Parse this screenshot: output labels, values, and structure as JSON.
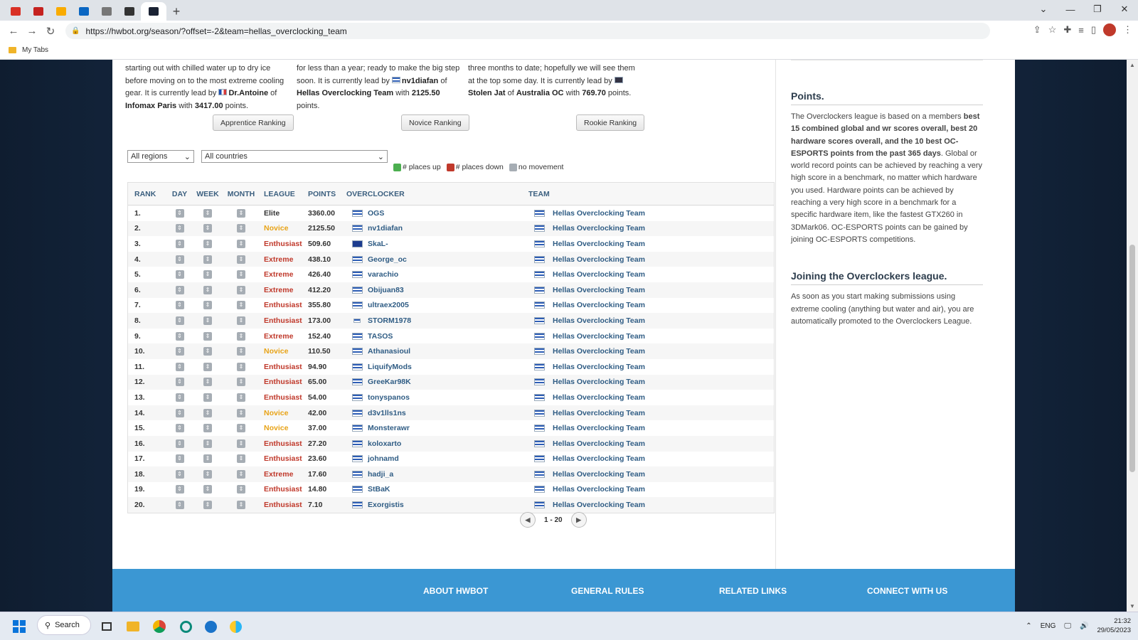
{
  "browser": {
    "url": "https://hwbot.org/season/?offset=-2&team=hellas_overclocking_team",
    "bookmark_folder": "My Tabs",
    "tabs": [
      {
        "icon": "gmail-icon",
        "color": "#d93025"
      },
      {
        "icon": "g-app-icon",
        "color": "#c5221f"
      },
      {
        "icon": "bookmark-tab-icon",
        "color": "#f9ab00"
      },
      {
        "icon": "linkedin-icon",
        "color": "#0a66c2"
      },
      {
        "icon": "flag-tab-icon",
        "color": "#777777"
      },
      {
        "icon": "audio-tab-icon",
        "color": "#333333"
      },
      {
        "icon": "hwbot-tab-icon",
        "color": "#1a2233",
        "active": true
      }
    ]
  },
  "intro": {
    "col1": {
      "pre": "starting out with chilled water up to dry ice before moving on to the most extreme cooling gear. It is currently lead by ",
      "leader": "Dr.Antoine",
      "mid": " of ",
      "team": "Infomax Paris",
      "with": " with ",
      "points": "3417.00",
      "post": " points."
    },
    "col2": {
      "pre": "for less than a year; ready to make the big step soon. It is currently lead by ",
      "leader": "nv1diafan",
      "mid": " of ",
      "team": "Hellas Overclocking Team",
      "with": " with ",
      "points": "2125.50",
      "post": " points."
    },
    "col3": {
      "pre": "three months to date; hopefully we will see them at the top some day. It is currently lead by ",
      "leader": "Stolen Jat",
      "mid": " of ",
      "team": "Australia OC",
      "with": " with ",
      "points": "769.70",
      "post": " points."
    }
  },
  "buttons": {
    "apprentice": "Apprentice Ranking",
    "novice": "Novice Ranking",
    "rookie": "Rookie Ranking"
  },
  "filters": {
    "region": "All regions",
    "country": "All countries"
  },
  "legend": {
    "up": "# places up",
    "down": "# places down",
    "none": "no movement"
  },
  "colors": {
    "elite": "#333333",
    "novice": "#e8a317",
    "enthusiast": "#c0392b",
    "extreme": "#c0392b",
    "up": "#4caf50",
    "down": "#c0392b",
    "none": "#a6adb4"
  },
  "table": {
    "headers": {
      "rank": "RANK",
      "day": "DAY",
      "week": "WEEK",
      "month": "MONTH",
      "league": "LEAGUE",
      "points": "POINTS",
      "overclocker": "OVERCLOCKER",
      "team": "TEAM"
    },
    "rows": [
      {
        "rank": "1.",
        "league": "Elite",
        "points": "3360.00",
        "name": "OGS",
        "team": "Hellas Overclocking Team",
        "flag": "gr"
      },
      {
        "rank": "2.",
        "league": "Novice",
        "points": "2125.50",
        "name": "nv1diafan",
        "team": "Hellas Overclocking Team",
        "flag": "gr"
      },
      {
        "rank": "3.",
        "league": "Enthusiast",
        "points": "509.60",
        "name": "SkaL-",
        "team": "Hellas Overclocking Team",
        "flag": "gr2"
      },
      {
        "rank": "4.",
        "league": "Extreme",
        "points": "438.10",
        "name": "George_oc",
        "team": "Hellas Overclocking Team",
        "flag": "gr"
      },
      {
        "rank": "5.",
        "league": "Extreme",
        "points": "426.40",
        "name": "varachio",
        "team": "Hellas Overclocking Team",
        "flag": "gr"
      },
      {
        "rank": "6.",
        "league": "Extreme",
        "points": "412.20",
        "name": "Obijuan83",
        "team": "Hellas Overclocking Team",
        "flag": "gr"
      },
      {
        "rank": "7.",
        "league": "Enthusiast",
        "points": "355.80",
        "name": "ultraex2005",
        "team": "Hellas Overclocking Team",
        "flag": "gr"
      },
      {
        "rank": "8.",
        "league": "Enthusiast",
        "points": "173.00",
        "name": "STORM1978",
        "team": "Hellas Overclocking Team",
        "flag": "small"
      },
      {
        "rank": "9.",
        "league": "Extreme",
        "points": "152.40",
        "name": "TASOS",
        "team": "Hellas Overclocking Team",
        "flag": "gr"
      },
      {
        "rank": "10.",
        "league": "Novice",
        "points": "110.50",
        "name": "Athanasioul",
        "team": "Hellas Overclocking Team",
        "flag": "gr"
      },
      {
        "rank": "11.",
        "league": "Enthusiast",
        "points": "94.90",
        "name": "LiquifyMods",
        "team": "Hellas Overclocking Team",
        "flag": "gr"
      },
      {
        "rank": "12.",
        "league": "Enthusiast",
        "points": "65.00",
        "name": "GreeKar98K",
        "team": "Hellas Overclocking Team",
        "flag": "gr"
      },
      {
        "rank": "13.",
        "league": "Enthusiast",
        "points": "54.00",
        "name": "tonyspanos",
        "team": "Hellas Overclocking Team",
        "flag": "gr"
      },
      {
        "rank": "14.",
        "league": "Novice",
        "points": "42.00",
        "name": "d3v1lls1ns",
        "team": "Hellas Overclocking Team",
        "flag": "gr"
      },
      {
        "rank": "15.",
        "league": "Novice",
        "points": "37.00",
        "name": "Monsterawr",
        "team": "Hellas Overclocking Team",
        "flag": "gr"
      },
      {
        "rank": "16.",
        "league": "Enthusiast",
        "points": "27.20",
        "name": "koloxarto",
        "team": "Hellas Overclocking Team",
        "flag": "gr"
      },
      {
        "rank": "17.",
        "league": "Enthusiast",
        "points": "23.60",
        "name": "johnamd",
        "team": "Hellas Overclocking Team",
        "flag": "gr"
      },
      {
        "rank": "18.",
        "league": "Extreme",
        "points": "17.60",
        "name": "hadji_a",
        "team": "Hellas Overclocking Team",
        "flag": "gr"
      },
      {
        "rank": "19.",
        "league": "Enthusiast",
        "points": "14.80",
        "name": "StBaK",
        "team": "Hellas Overclocking Team",
        "flag": "gr"
      },
      {
        "rank": "20.",
        "league": "Enthusiast",
        "points": "7.10",
        "name": "Exorgistis",
        "team": "Hellas Overclocking Team",
        "flag": "gr"
      }
    ]
  },
  "pager": {
    "range": "1 - 20"
  },
  "sidebar": {
    "points_title": "Points.",
    "points_p1": "The Overclockers league is based on a members ",
    "points_b1": "best 15 combined global and wr scores overall, best 20 hardware scores overall, and the 10 best OC-ESPORTS points from the past 365 days",
    "points_p2": ". Global or world record points can be achieved by reaching a very high score in a benchmark, no matter which hardware you used. Hardware points can be achieved by reaching a very high score in a benchmark for a specific hardware item, like the fastest GTX260 in 3DMark06. OC-ESPORTS points can be gained by joining OC-ESPORTS competitions.",
    "join_title": "Joining the Overclockers league.",
    "join_p": "As soon as you start making submissions using extreme cooling (anything but water and air), you are automatically promoted to the Overclockers League."
  },
  "footer": {
    "about": "ABOUT HWBOT",
    "rules": "GENERAL RULES",
    "links": "RELATED LINKS",
    "connect": "CONNECT WITH US"
  },
  "taskbar": {
    "search": "Search",
    "lang": "ENG",
    "time": "21:32",
    "date": "29/05/2023"
  }
}
